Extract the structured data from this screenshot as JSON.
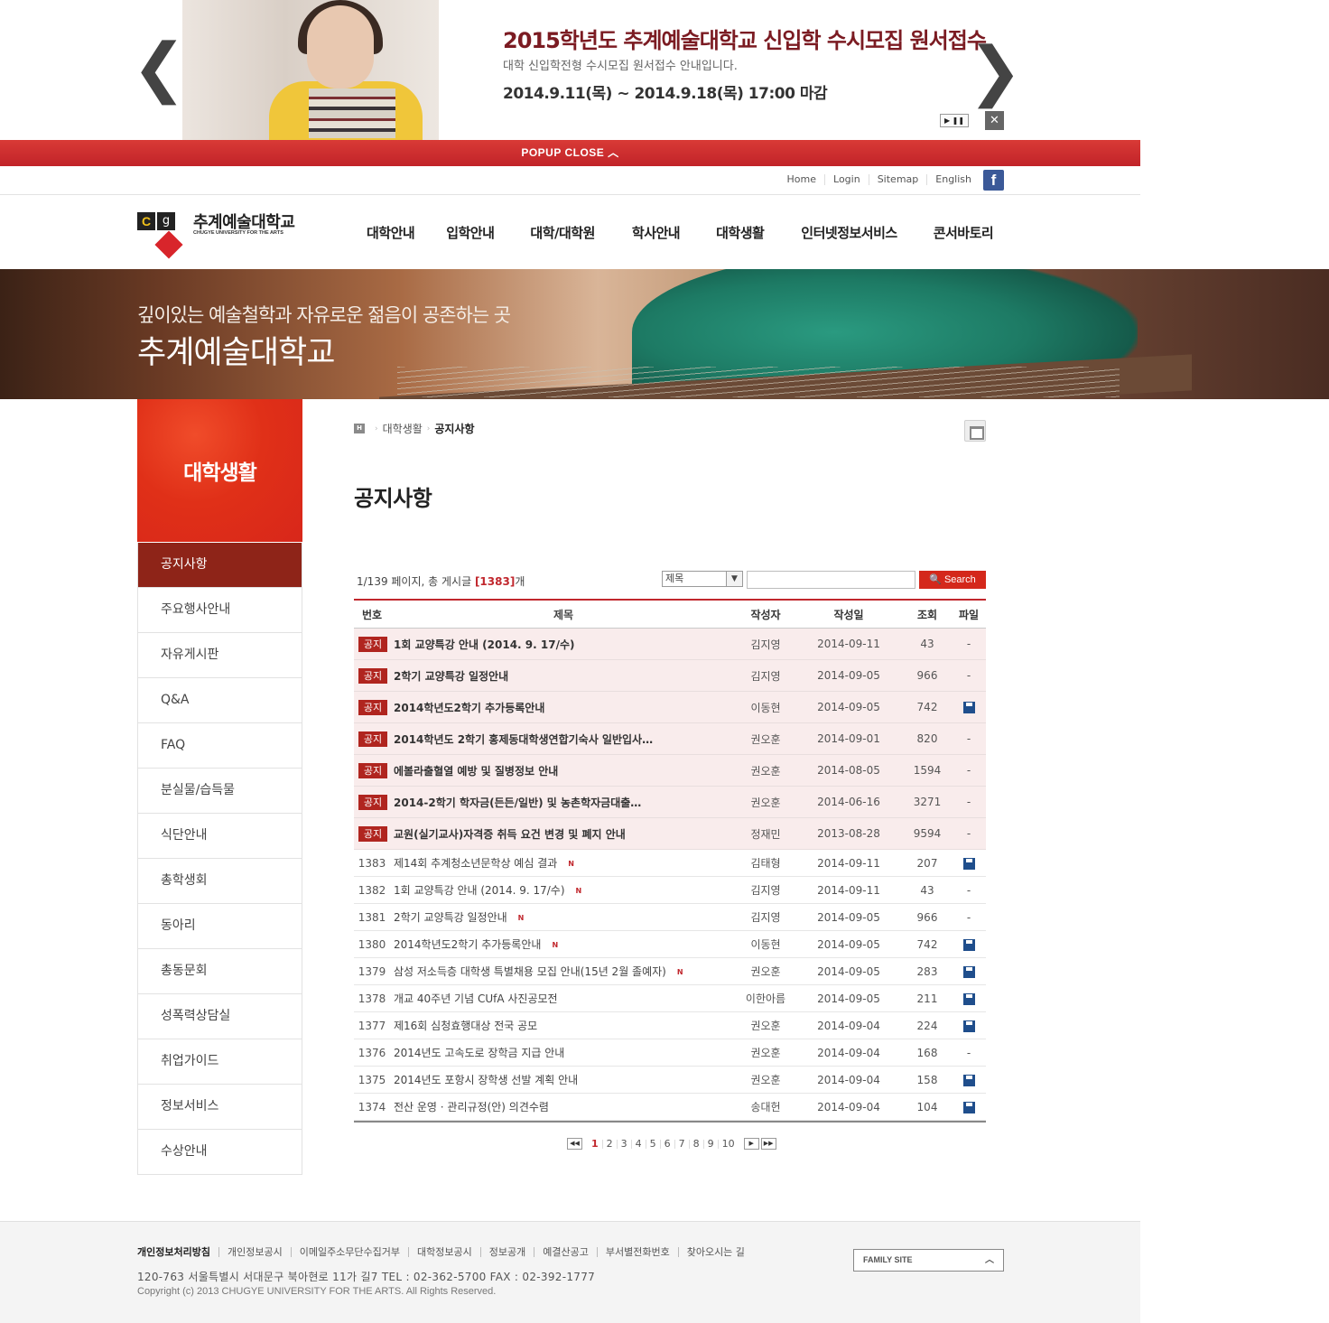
{
  "popup": {
    "title": "2015학년도 추계예술대학교 신입학 수시모집 원서접수",
    "subtitle": "대학 신입학전형 수시모집 원서접수 안내입니다.",
    "date": "2014.9.11(목) ~ 2014.9.18(목) 17:00 마감",
    "prev": "❮",
    "next": "❯",
    "play_pause": "▶ ❚❚",
    "close_x": "✕",
    "close_bar": "POPUP CLOSE  ︿"
  },
  "util": {
    "home": "Home",
    "login": "Login",
    "sitemap": "Sitemap",
    "english": "English",
    "facebook": "f"
  },
  "logo": {
    "korean": "추계예술대학교",
    "english": "CHUGYE UNIVERSITY FOR THE ARTS",
    "mark_c": "C",
    "mark_g": "g"
  },
  "gnb": [
    "대학안내",
    "입학안내",
    "대학/대학원",
    "학사안내",
    "대학생활",
    "인터넷정보서비스",
    "콘서바토리"
  ],
  "visual": {
    "line1": "깊이있는 예술철학과 자유로운 젊음이 공존하는 곳",
    "line2": "추계예술대학교"
  },
  "lnb": {
    "title": "대학생활",
    "items": [
      "공지사항",
      "주요행사안내",
      "자유게시판",
      "Q&A",
      "FAQ",
      "분실물/습득물",
      "식단안내",
      "총학생회",
      "동아리",
      "총동문회",
      "성폭력상담실",
      "취업가이드",
      "정보서비스",
      "수상안내"
    ]
  },
  "location": {
    "home": "H",
    "sep1": "›",
    "sep2": "›",
    "parent": "대학생활",
    "current": "공지사항"
  },
  "page_title": "공지사항",
  "board_info": {
    "prefix": "1/139 페이지, 총 게시글 ",
    "total": "[1383]",
    "suffix": "개"
  },
  "search": {
    "select_value": "제목",
    "select_arrow": "▼",
    "button": "🔍 Search"
  },
  "table": {
    "headers": {
      "no": "번호",
      "title": "제목",
      "writer": "작성자",
      "date": "작성일",
      "hits": "조회",
      "file": "파일"
    },
    "notice_label": "공지",
    "new_label": "N",
    "no_file": "-",
    "notices": [
      {
        "title": "1회 교양특강 안내 (2014. 9. 17/수)",
        "writer": "김지영",
        "date": "2014-09-11",
        "hits": "43",
        "file": false
      },
      {
        "title": "2학기 교양특강 일정안내",
        "writer": "김지영",
        "date": "2014-09-05",
        "hits": "966",
        "file": false
      },
      {
        "title": "2014학년도2학기 추가등록안내",
        "writer": "이동현",
        "date": "2014-09-05",
        "hits": "742",
        "file": true
      },
      {
        "title": "2014학년도 2학기 홍제동대학생연합기숙사 일반입사…",
        "writer": "권오훈",
        "date": "2014-09-01",
        "hits": "820",
        "file": false
      },
      {
        "title": "에볼라출혈열 예방 및 질병정보 안내",
        "writer": "권오훈",
        "date": "2014-08-05",
        "hits": "1594",
        "file": false
      },
      {
        "title": "2014-2학기 학자금(든든/일반) 및 농촌학자금대출…",
        "writer": "권오훈",
        "date": "2014-06-16",
        "hits": "3271",
        "file": false
      },
      {
        "title": "교원(실기교사)자격증 취득 요건 변경 및 폐지 안내",
        "writer": "정재민",
        "date": "2013-08-28",
        "hits": "9594",
        "file": false
      }
    ],
    "rows": [
      {
        "no": "1383",
        "title": "제14회 추계청소년문학상 예심 결과",
        "new": true,
        "writer": "김태형",
        "date": "2014-09-11",
        "hits": "207",
        "file": true
      },
      {
        "no": "1382",
        "title": "1회 교양특강 안내 (2014. 9. 17/수)",
        "new": true,
        "writer": "김지영",
        "date": "2014-09-11",
        "hits": "43",
        "file": false
      },
      {
        "no": "1381",
        "title": "2학기 교양특강 일정안내",
        "new": true,
        "writer": "김지영",
        "date": "2014-09-05",
        "hits": "966",
        "file": false
      },
      {
        "no": "1380",
        "title": "2014학년도2학기 추가등록안내",
        "new": true,
        "writer": "이동현",
        "date": "2014-09-05",
        "hits": "742",
        "file": true
      },
      {
        "no": "1379",
        "title": "삼성 저소득층 대학생 특별채용 모집 안내(15년 2월 졸예자)",
        "new": true,
        "writer": "권오훈",
        "date": "2014-09-05",
        "hits": "283",
        "file": true
      },
      {
        "no": "1378",
        "title": "개교 40주년 기념 CUfA 사진공모전",
        "new": false,
        "writer": "이한아름",
        "date": "2014-09-05",
        "hits": "211",
        "file": true
      },
      {
        "no": "1377",
        "title": "제16회 심청효행대상 전국 공모",
        "new": false,
        "writer": "권오훈",
        "date": "2014-09-04",
        "hits": "224",
        "file": true
      },
      {
        "no": "1376",
        "title": "2014년도 고속도로 장학금 지급 안내",
        "new": false,
        "writer": "권오훈",
        "date": "2014-09-04",
        "hits": "168",
        "file": false
      },
      {
        "no": "1375",
        "title": "2014년도 포항시 장학생 선발 계획 안내",
        "new": false,
        "writer": "권오훈",
        "date": "2014-09-04",
        "hits": "158",
        "file": true
      },
      {
        "no": "1374",
        "title": "전산 운영 · 관리규정(안) 의견수렴",
        "new": false,
        "writer": "송대헌",
        "date": "2014-09-04",
        "hits": "104",
        "file": true
      }
    ]
  },
  "paging": {
    "first": "◀◀",
    "prev": "◀",
    "pages": [
      "1",
      "2",
      "3",
      "4",
      "5",
      "6",
      "7",
      "8",
      "9",
      "10"
    ],
    "current": "1",
    "next": "▶",
    "last": "▶▶"
  },
  "footer": {
    "links": [
      "개인정보처리방침",
      "개인정보공시",
      "이메일주소무단수집거부",
      "대학정보공시",
      "정보공개",
      "예결산공고",
      "부서별전화번호",
      "찾아오시는 길"
    ],
    "address": "120-763 서울특별시 서대문구 북아현로 11가 길7 TEL : 02-362-5700 FAX : 02-392-1777",
    "copyright": "Copyright (c) 2013 CHUGYE UNIVERSITY FOR THE ARTS. All Rights Reserved.",
    "family_site": "FAMILY SITE",
    "family_chev": "︿"
  },
  "colors": {
    "brand_red": "#c1272d",
    "lnb_active": "#8e2418",
    "popup_title": "#7b1b22"
  }
}
